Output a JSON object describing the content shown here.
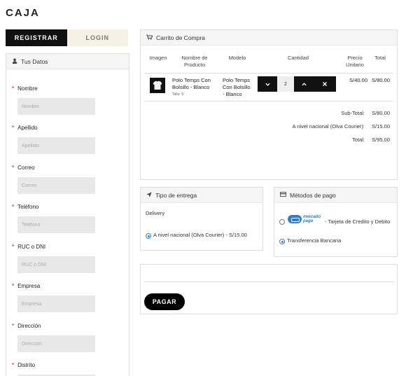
{
  "page": {
    "title": "CAJA"
  },
  "tabs": [
    {
      "label": "REGISTRAR",
      "active": true
    },
    {
      "label": "LOGIN",
      "active": false
    }
  ],
  "datos": {
    "title": "Tus Datos",
    "icon": "user-icon",
    "fields": [
      {
        "label": "Nombre",
        "placeholder": "Nombre"
      },
      {
        "label": "Apellido",
        "placeholder": "Apellido"
      },
      {
        "label": "Correo",
        "placeholder": "Correo"
      },
      {
        "label": "Teléfono",
        "placeholder": "Teléfono"
      },
      {
        "label": "RUC o DNI",
        "placeholder": "RUC o DNI"
      },
      {
        "label": "Empresa",
        "placeholder": "Empresa"
      },
      {
        "label": "Dirección",
        "placeholder": "Dirección"
      },
      {
        "label": "Distrito",
        "placeholder": ""
      }
    ]
  },
  "cart": {
    "title": "Carrito de Compra",
    "icon": "shopping-cart-icon",
    "headers": {
      "image": "Imagen",
      "name": "Nombre de Producto",
      "model": "Modelo",
      "qty": "Cantidad",
      "unit": "Precio Unitario",
      "total": "Total"
    },
    "item": {
      "name": "Polo Temps Con Bolsillo - Blanco",
      "size": "Talla: S",
      "model": "Polo Temps Con Bolsillo - Blanco",
      "qty": "2",
      "unit_price": "S/40.00",
      "total": "S/80.00"
    },
    "totals": [
      {
        "label": "Sub-Total:",
        "value": "S/80.00"
      },
      {
        "label": "A nivel nacional (Olva Courier):",
        "value": "S/15.00"
      },
      {
        "label": "Total:",
        "value": "S/95.00"
      }
    ]
  },
  "delivery": {
    "title": "Tipo de entrega",
    "icon": "paper-plane-icon",
    "subtitle": "Delivery",
    "option": "A nivel nacional (Olva Courier) - S/15.00"
  },
  "payment": {
    "title": "Métodos de pago",
    "icon": "credit-card-icon",
    "options": [
      {
        "logo": "mercado pago",
        "label": "- Tarjeta de Credito y Debito",
        "checked": false
      },
      {
        "label": "Transferencia Bancaria",
        "checked": true
      }
    ]
  },
  "pay": {
    "button": "PAGAR"
  }
}
